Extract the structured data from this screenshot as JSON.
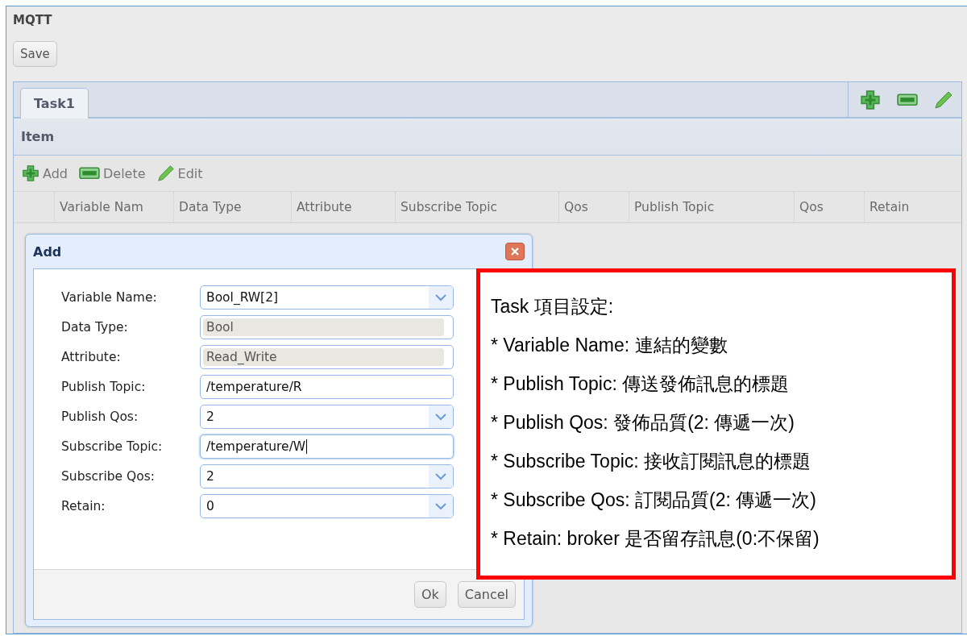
{
  "page": {
    "title": "MQTT",
    "save_button": "Save"
  },
  "tabs": [
    {
      "label": "Task1",
      "selected": true
    }
  ],
  "panel": {
    "title": "Item"
  },
  "toolbar": [
    {
      "kind": "add",
      "label": "Add"
    },
    {
      "kind": "delete",
      "label": "Delete"
    },
    {
      "kind": "edit",
      "label": "Edit"
    }
  ],
  "table": {
    "columns": [
      "Variable Nam",
      "Data Type",
      "Attribute",
      "Subscribe Topic",
      "Qos",
      "Publish Topic",
      "Qos",
      "Retain"
    ]
  },
  "dialog": {
    "title": "Add",
    "fields": [
      {
        "label": "Variable Name:",
        "value": "Bool_RW[2]",
        "kind": "select",
        "focused": false
      },
      {
        "label": "Data Type:",
        "value": "Bool",
        "kind": "readonly",
        "focused": false
      },
      {
        "label": "Attribute:",
        "value": "Read_Write",
        "kind": "readonly",
        "focused": false
      },
      {
        "label": "Publish Topic:",
        "value": "/temperature/R",
        "kind": "text",
        "focused": false
      },
      {
        "label": "Publish Qos:",
        "value": "2",
        "kind": "select",
        "focused": false
      },
      {
        "label": "Subscribe Topic:",
        "value": "/temperature/W",
        "kind": "text",
        "focused": true
      },
      {
        "label": "Subscribe Qos:",
        "value": "2",
        "kind": "select",
        "focused": false
      },
      {
        "label": "Retain:",
        "value": "0",
        "kind": "select",
        "focused": false
      }
    ],
    "buttons": [
      "Ok",
      "Cancel"
    ]
  },
  "callout": {
    "lines": [
      "Task 項目設定:",
      "* Variable Name:  連結的變數",
      "* Publish Topic:  傳送發佈訊息的標題",
      "* Publish Qos:  發佈品質(2:  傳遞一次)",
      "* Subscribe Topic:  接收訂閱訊息的標題",
      "* Subscribe Qos:  訂閱品質(2:  傳遞一次)",
      "* Retain: broker 是否留存訊息(0:不保留)"
    ]
  }
}
